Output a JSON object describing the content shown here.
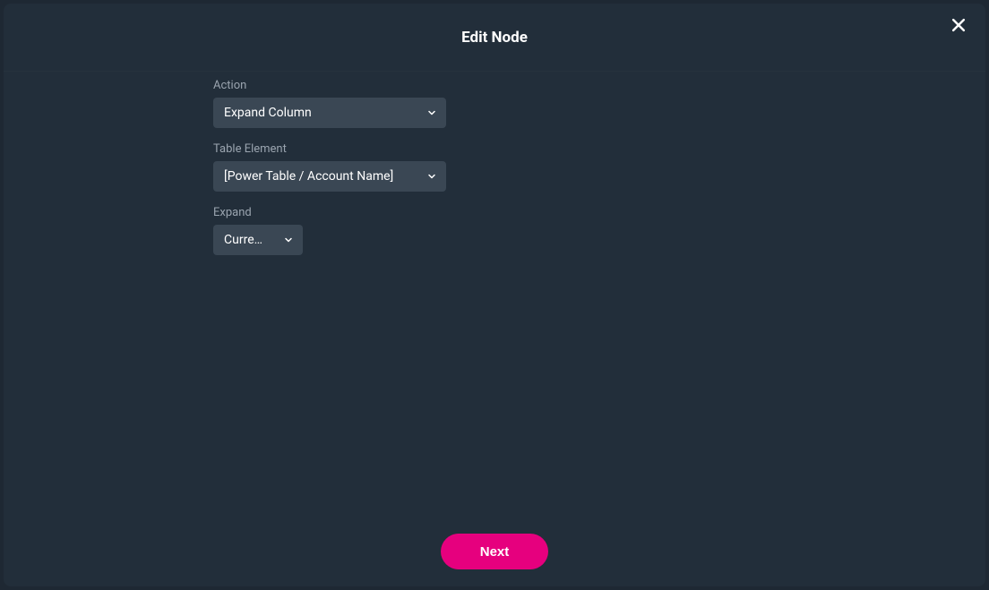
{
  "modal": {
    "title": "Edit Node",
    "fields": {
      "action": {
        "label": "Action",
        "value": "Expand Column"
      },
      "table_element": {
        "label": "Table Element",
        "value": "[Power Table / Account Name]"
      },
      "expand": {
        "label": "Expand",
        "value": "Curre…"
      }
    },
    "footer": {
      "next_label": "Next"
    }
  },
  "colors": {
    "accent": "#e6007e",
    "modal_bg": "#222e3a",
    "select_bg": "#3a4754",
    "label": "#9aa4af"
  }
}
